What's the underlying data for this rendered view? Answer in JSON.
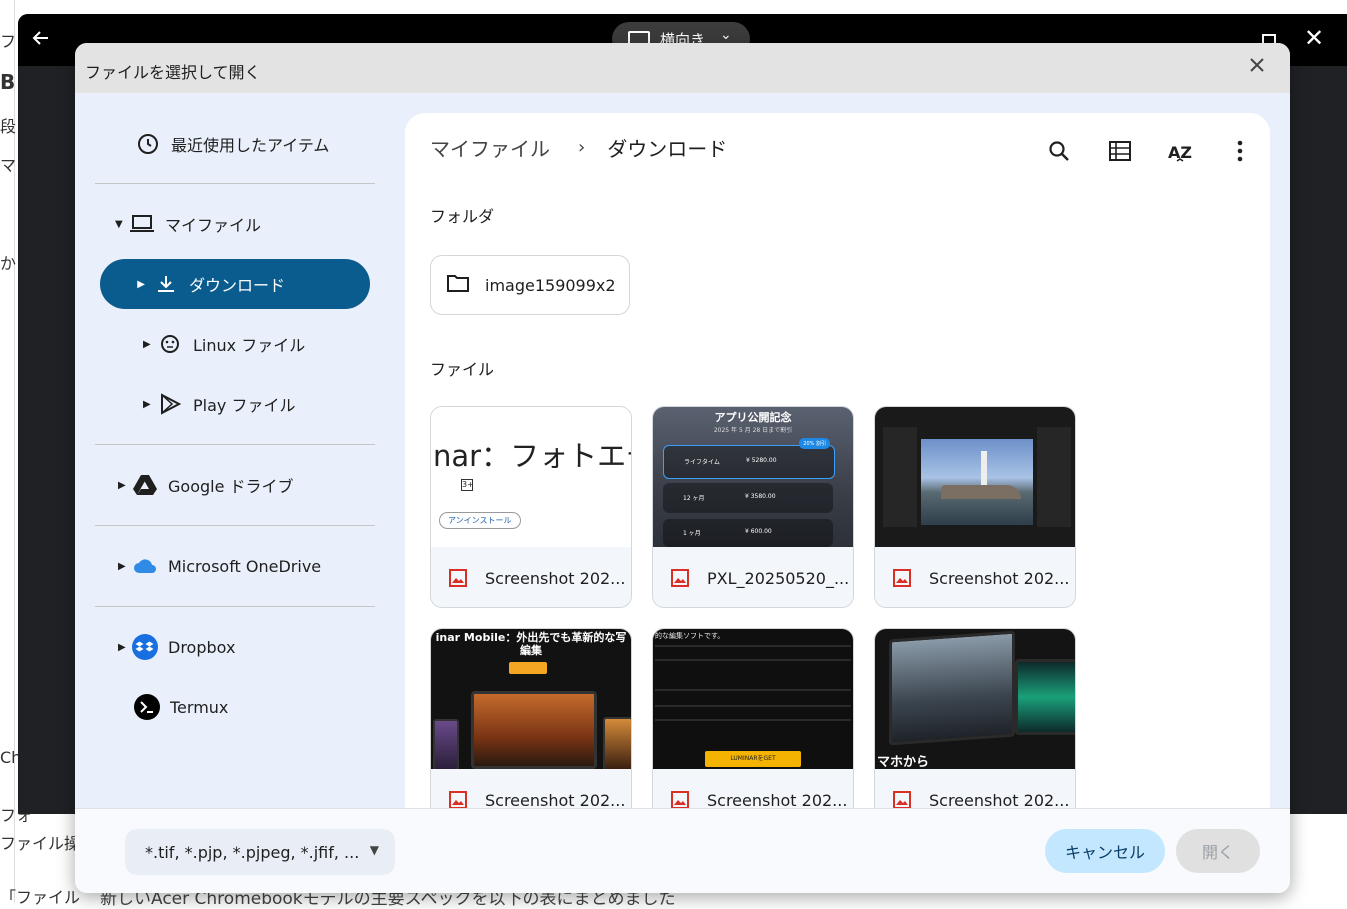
{
  "background": {
    "fragments": [
      "ファ",
      "B",
      "段",
      "マ",
      "か",
      "Ch",
      "フォ",
      "ファイル操",
      "「ファイル"
    ],
    "bottom_text": "新しいAcer Chromebookモデルの主要スペックを以下の表にまとめました"
  },
  "app_window": {
    "orientation_label": "横向き"
  },
  "dialog": {
    "title": "ファイルを選択して開く",
    "sidebar": {
      "recent": "最近使用したアイテム",
      "my_files": "マイファイル",
      "downloads": "ダウンロード",
      "linux": "Linux ファイル",
      "play": "Play ファイル",
      "google_drive": "Google ドライブ",
      "onedrive": "Microsoft OneDrive",
      "dropbox": "Dropbox",
      "termux": "Termux"
    },
    "breadcrumb": {
      "root": "マイファイル",
      "separator": "›",
      "current": "ダウンロード"
    },
    "sections": {
      "folders": "フォルダ",
      "files": "ファイル"
    },
    "folders": [
      {
        "name": "image159099x2"
      }
    ],
    "files": [
      {
        "name": "Screenshot 202...",
        "thumb_text": "nar：フォトエデ",
        "thumb_sub": "3+",
        "thumb_btn": "アンインストール"
      },
      {
        "name": "PXL_20250520_...",
        "thumb_title": "アプリ公開記念",
        "thumb_sub": "2025 年 5 月 28 日まで割引",
        "badge": "20% 割引",
        "plans": [
          "ライフタイム",
          "12 ヶ月",
          "1 ヶ月"
        ],
        "prices": [
          "¥ 5280.00",
          "¥ 3580.00",
          "¥ 600.00"
        ]
      },
      {
        "name": "Screenshot 202..."
      },
      {
        "name": "Screenshot 202...",
        "thumb_title": "inar Mobile：外出先でも革新的な写",
        "thumb_sub": "編集"
      },
      {
        "name": "Screenshot 202...",
        "thumb_text": "的な編集ソフトです。",
        "thumb_btn": "LUMINARをGET"
      },
      {
        "name": "Screenshot 202...",
        "thumb_text": "マホから"
      }
    ],
    "footer": {
      "filter_value": "*.tif, *.pjp, *.pjpeg, *.jfif, ...",
      "cancel_label": "キャンセル",
      "open_label": "開く"
    }
  },
  "icons": {
    "search": "search-icon",
    "list_view": "list-view-icon",
    "sort": "sort-az-icon",
    "more": "more-vert-icon"
  },
  "colors": {
    "accent": "#0a5b8e",
    "cancel_bg": "#c2e7ff",
    "panel_bg": "#e9f0fb"
  }
}
